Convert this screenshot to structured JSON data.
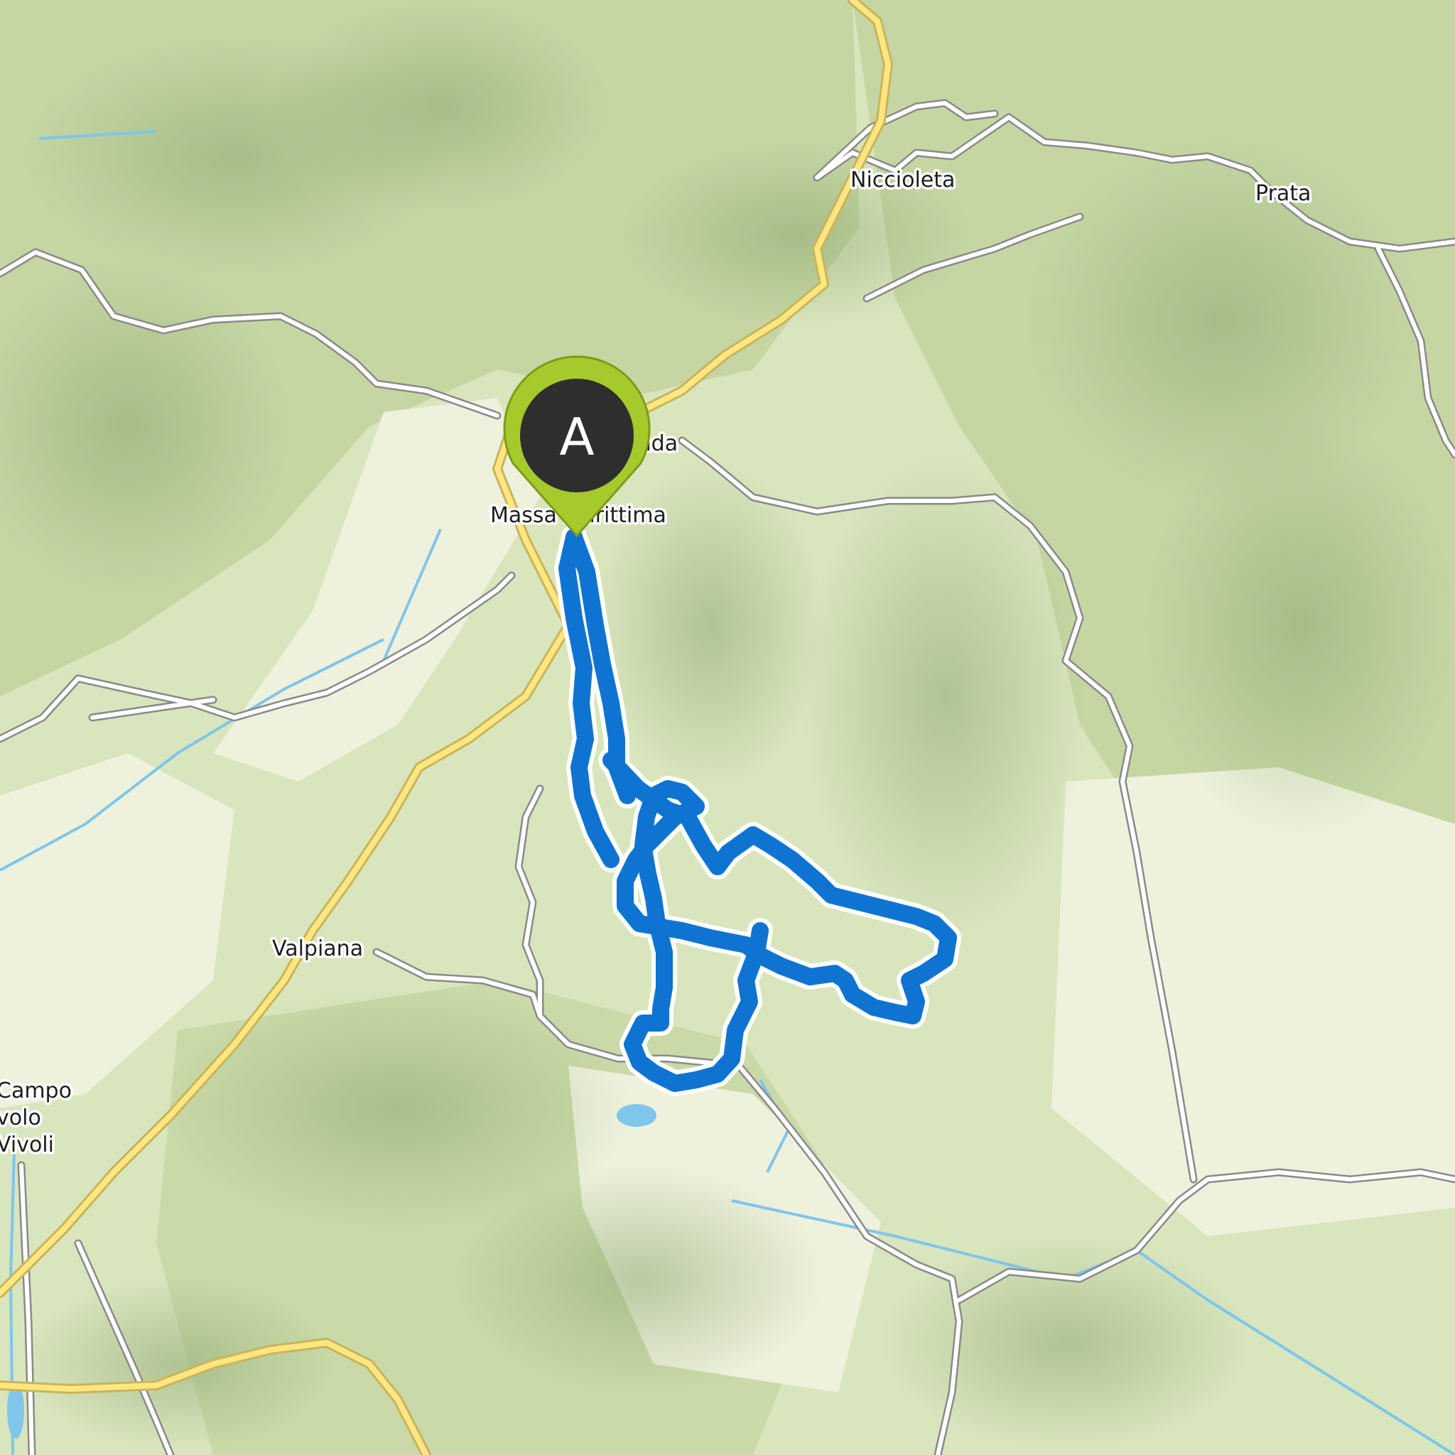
{
  "map": {
    "places": [
      "Niccioleta",
      "Prata",
      "Ghirlanda",
      "Massa Marittima",
      "Valpiana",
      "Campo volo Vivoli"
    ],
    "start_marker": {
      "letter": "A",
      "color": "#a6c92c",
      "place": "Massa Marittima"
    },
    "route_color": "#0f74d1",
    "terrain_colors": {
      "lowland": "#eef1dc",
      "forest": "#c9d9a8",
      "ridge": "#9fb783",
      "water": "#7ec6ec"
    },
    "road_colors": {
      "main": "#ffe680",
      "secondary": "#ffffff"
    }
  }
}
